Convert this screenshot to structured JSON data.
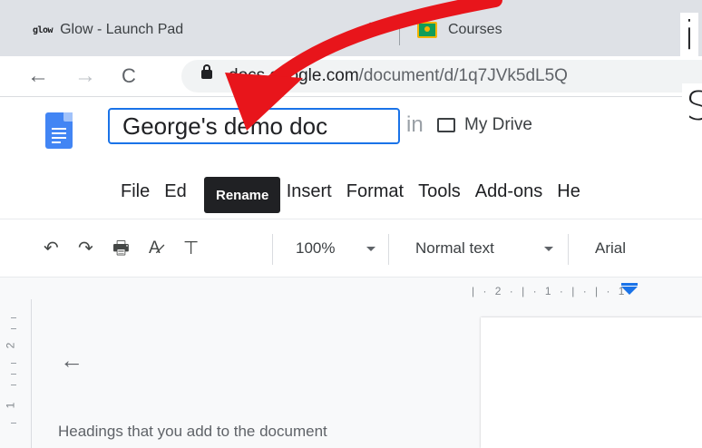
{
  "browser": {
    "tabs": [
      {
        "favicon_text": "glow",
        "label": "Glow - Launch Pad"
      },
      {
        "label": "Courses"
      }
    ],
    "url_prefix": "do",
    "url_host": "cs.google.com",
    "url_path": "/document/d/1q7JVk5dL5Q"
  },
  "docs": {
    "title": "George's demo doc",
    "location_prefix": "in",
    "location": "My Drive",
    "menu": [
      "File",
      "Ed",
      "Insert",
      "Format",
      "Tools",
      "Add-ons",
      "He"
    ],
    "tooltip": "Rename",
    "toolbar": {
      "zoom": "100%",
      "style": "Normal text",
      "font": "Arial"
    },
    "ruler_top": "| · 2 · | · 1 · | · | · 1",
    "ruler_left": [
      "2",
      "1"
    ],
    "outline_hint": "Headings that you add to the document"
  },
  "annotation": {
    "arrow_color": "#e8151b",
    "corner_letters": [
      "i",
      "S"
    ]
  },
  "colors": {
    "accent": "#1a73e8",
    "docs_blue": "#4285f4"
  }
}
